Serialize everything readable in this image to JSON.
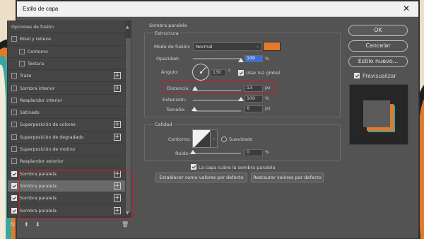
{
  "colors": {
    "dialog_bg": "#535353",
    "accent_orange": "#e07a2e",
    "highlight_red": "#c41f2b",
    "selected_field": "#3a6fd8",
    "preview_shadow_orange": "#e07a2e",
    "preview_shadow_teal": "#3aa6a0",
    "preview_square": "#5b5b5b"
  },
  "window": {
    "title": "Estilo de capa",
    "close_icon": "close-icon"
  },
  "left_panel": {
    "items": [
      {
        "label": "Opciones de fusión",
        "checkbox": false,
        "checked": false,
        "plus": false,
        "selected": false,
        "sub": false
      },
      {
        "label": "Bisel y relieve",
        "checkbox": true,
        "checked": false,
        "plus": false,
        "selected": false,
        "sub": false
      },
      {
        "label": "Contorno",
        "checkbox": true,
        "checked": false,
        "plus": false,
        "selected": false,
        "sub": true
      },
      {
        "label": "Textura",
        "checkbox": true,
        "checked": false,
        "plus": false,
        "selected": false,
        "sub": true
      },
      {
        "label": "Trazo",
        "checkbox": true,
        "checked": false,
        "plus": true,
        "selected": false,
        "sub": false
      },
      {
        "label": "Sombra interior",
        "checkbox": true,
        "checked": false,
        "plus": true,
        "selected": false,
        "sub": false
      },
      {
        "label": "Resplandor interior",
        "checkbox": true,
        "checked": false,
        "plus": false,
        "selected": false,
        "sub": false
      },
      {
        "label": "Satinado",
        "checkbox": true,
        "checked": false,
        "plus": false,
        "selected": false,
        "sub": false
      },
      {
        "label": "Superposición de colores",
        "checkbox": true,
        "checked": false,
        "plus": true,
        "selected": false,
        "sub": false
      },
      {
        "label": "Superposición de degradado",
        "checkbox": true,
        "checked": false,
        "plus": true,
        "selected": false,
        "sub": false
      },
      {
        "label": "Superposición de motivo",
        "checkbox": true,
        "checked": false,
        "plus": false,
        "selected": false,
        "sub": false
      },
      {
        "label": "Resplandor exterior",
        "checkbox": true,
        "checked": false,
        "plus": false,
        "selected": false,
        "sub": false
      },
      {
        "label": "Sombra paralela",
        "checkbox": true,
        "checked": true,
        "plus": true,
        "selected": false,
        "sub": false
      },
      {
        "label": "Sombra paralela",
        "checkbox": true,
        "checked": true,
        "plus": true,
        "selected": true,
        "sub": false
      },
      {
        "label": "Sombra paralela",
        "checkbox": true,
        "checked": true,
        "plus": true,
        "selected": false,
        "sub": false
      },
      {
        "label": "Sombra paralela",
        "checkbox": true,
        "checked": true,
        "plus": true,
        "selected": false,
        "sub": false
      }
    ],
    "tools": {
      "fx": "fx",
      "up_icon": "arrow-up-icon",
      "down_icon": "arrow-down-icon",
      "trash_icon": "trash-icon"
    }
  },
  "drop_shadow": {
    "section_title": "Sombra paralela",
    "structure_title": "Estructura",
    "blend_mode_label": "Modo de fusión:",
    "blend_mode_value": "Normal",
    "opacity_label": "Opacidad:",
    "opacity_value": "100",
    "opacity_unit": "%",
    "opacity_fraction": 1.0,
    "angle_label": "Ángulo:",
    "angle_value": "130",
    "angle_unit": "º",
    "global_light_label": "Usar luz global",
    "global_light_checked": true,
    "distance_label": "Distancia:",
    "distance_value": "13",
    "distance_unit": "px",
    "distance_fraction": 0.05,
    "spread_label": "Extensión:",
    "spread_value": "100",
    "spread_unit": "%",
    "spread_fraction": 1.0,
    "size_label": "Tamaño:",
    "size_value": "6",
    "size_unit": "px",
    "size_fraction": 0.03,
    "quality_title": "Calidad",
    "contour_label": "Contorno:",
    "antialias_label": "Suavizado",
    "antialias_checked": false,
    "noise_label": "Ruido:",
    "noise_value": "0",
    "noise_unit": "%",
    "noise_fraction": 0.0,
    "knockout_label": "La capa cubre la sombra paralela",
    "knockout_checked": true,
    "make_default_label": "Establecer como valores por defecto",
    "reset_default_label": "Restaurar valores por defecto"
  },
  "right": {
    "ok_label": "OK",
    "cancel_label": "Cancelar",
    "new_style_label": "Estilo nuevo...",
    "preview_label": "Previsualizar",
    "preview_checked": true
  }
}
